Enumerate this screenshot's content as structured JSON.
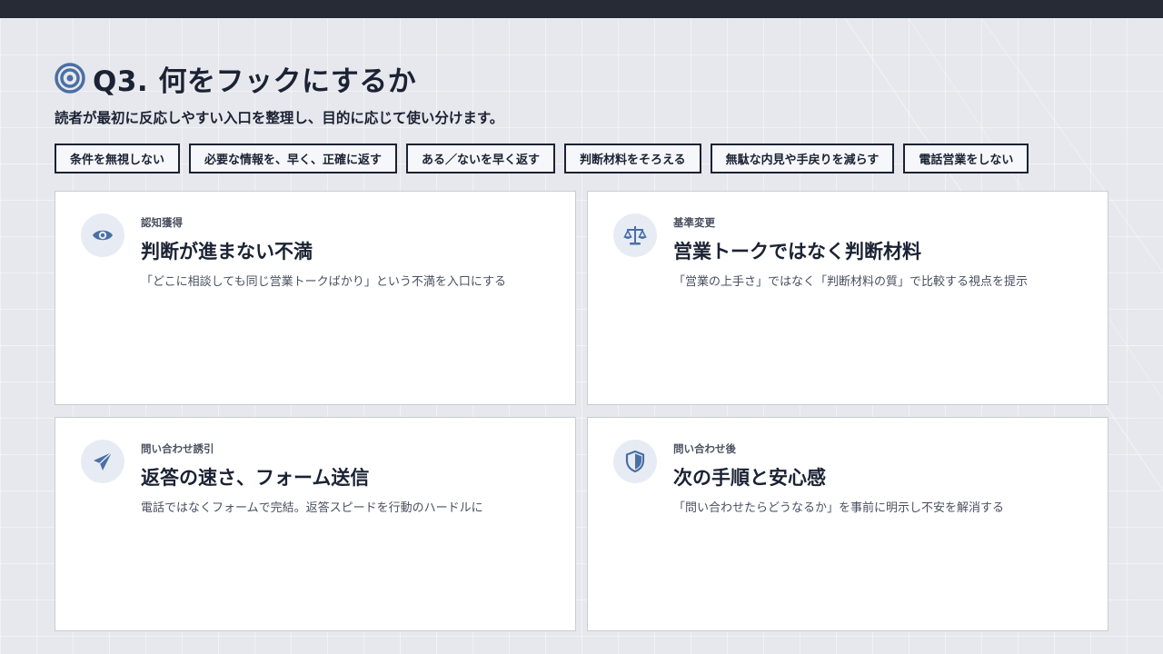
{
  "header": {
    "title": "Q3. 何をフックにするか",
    "title_icon": "target-icon",
    "subtitle": "読者が最初に反応しやすい入口を整理し、目的に応じて使い分けます。"
  },
  "chips": [
    "条件を無視しない",
    "必要な情報を、早く、正確に返す",
    "ある／ないを早く返す",
    "判断材料をそろえる",
    "無駄な内見や手戻りを減らす",
    "電話営業をしない"
  ],
  "cards": [
    {
      "tag": "認知獲得",
      "title": "判断が進まない不満",
      "desc": "「どこに相談しても同じ営業トークばかり」という不満を入口にする",
      "icon": "eye-icon"
    },
    {
      "tag": "基準変更",
      "title": "営業トークではなく判断材料",
      "desc": "「営業の上手さ」ではなく「判断材料の質」で比較する視点を提示",
      "icon": "scale-icon"
    },
    {
      "tag": "問い合わせ誘引",
      "title": "返答の速さ、フォーム送信",
      "desc": "電話ではなくフォームで完結。返答スピードを行動のハードルに",
      "icon": "paper-plane-icon"
    },
    {
      "tag": "問い合わせ後",
      "title": "次の手順と安心感",
      "desc": "「問い合わせたらどうなるか」を事前に明示し不安を解消する",
      "icon": "shield-icon"
    }
  ],
  "colors": {
    "accent": "#4a6fa5",
    "text": "#1b2233",
    "background": "#e7e8ed",
    "topbar": "#272b35"
  }
}
